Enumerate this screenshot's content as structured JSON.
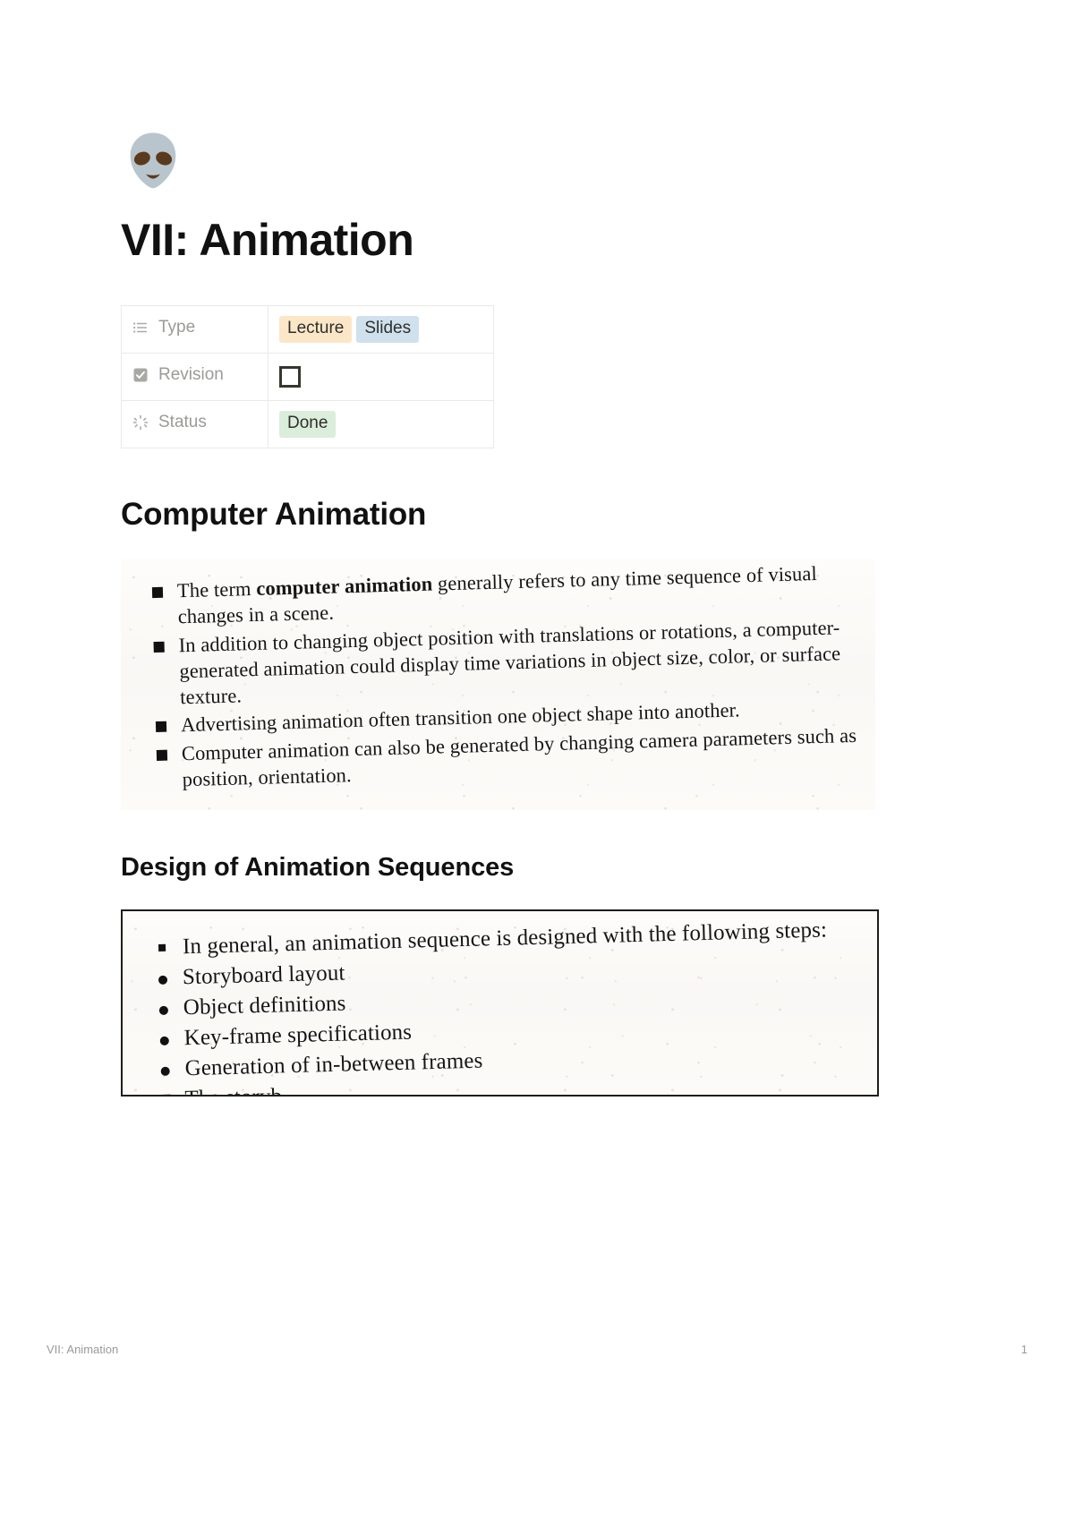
{
  "page": {
    "icon": "alien-emoji",
    "title": "VII: Animation"
  },
  "properties": [
    {
      "icon": "list-icon",
      "key": "Type",
      "type": "multi_select",
      "tags": [
        {
          "label": "Lecture",
          "color": "#fbe7c8"
        },
        {
          "label": "Slides",
          "color": "#cfe1ec"
        }
      ]
    },
    {
      "icon": "checkbox-icon",
      "key": "Revision",
      "type": "checkbox",
      "checked": false
    },
    {
      "icon": "status-icon",
      "key": "Status",
      "type": "select",
      "tags": [
        {
          "label": "Done",
          "color": "#dbeddb"
        }
      ]
    }
  ],
  "sections": [
    {
      "heading": "Computer Animation",
      "figure": {
        "name": "scanned-slide-computer-animation",
        "bordered": false,
        "items": [
          {
            "bullet": "square",
            "prefix": "The term ",
            "bold": "computer animation",
            "suffix": " generally refers to any time sequence of visual changes in a scene."
          },
          {
            "bullet": "square",
            "prefix": "In addition to changing object position with translations or rotations, a computer-generated animation could display time variations in object size, color, or surface texture.",
            "bold": "",
            "suffix": ""
          },
          {
            "bullet": "square",
            "prefix": "Advertising animation often transition one object shape into another.",
            "bold": "",
            "suffix": ""
          },
          {
            "bullet": "square",
            "prefix": "Computer animation can also be generated by changing camera parameters such as position, orientation.",
            "bold": "",
            "suffix": ""
          }
        ]
      }
    },
    {
      "heading": "Design of Animation Sequences",
      "figure": {
        "name": "scanned-slide-design-of-animation-sequences",
        "bordered": true,
        "items": [
          {
            "bullet": "square-small",
            "prefix": "In general, an animation sequence is designed with the following steps:",
            "bold": "",
            "suffix": ""
          },
          {
            "bullet": "dot",
            "prefix": "Storyboard layout",
            "bold": "",
            "suffix": ""
          },
          {
            "bullet": "dot",
            "prefix": "Object definitions",
            "bold": "",
            "suffix": ""
          },
          {
            "bullet": "dot",
            "prefix": "Key-frame specifications",
            "bold": "",
            "suffix": ""
          },
          {
            "bullet": "dot",
            "prefix": "Generation of in-between frames",
            "bold": "",
            "suffix": ""
          },
          {
            "bullet": "square",
            "prefix": "The storyb",
            "bold": "",
            "suffix": ""
          }
        ]
      }
    }
  ],
  "footer": {
    "left": "VII: Animation",
    "right": "1"
  }
}
